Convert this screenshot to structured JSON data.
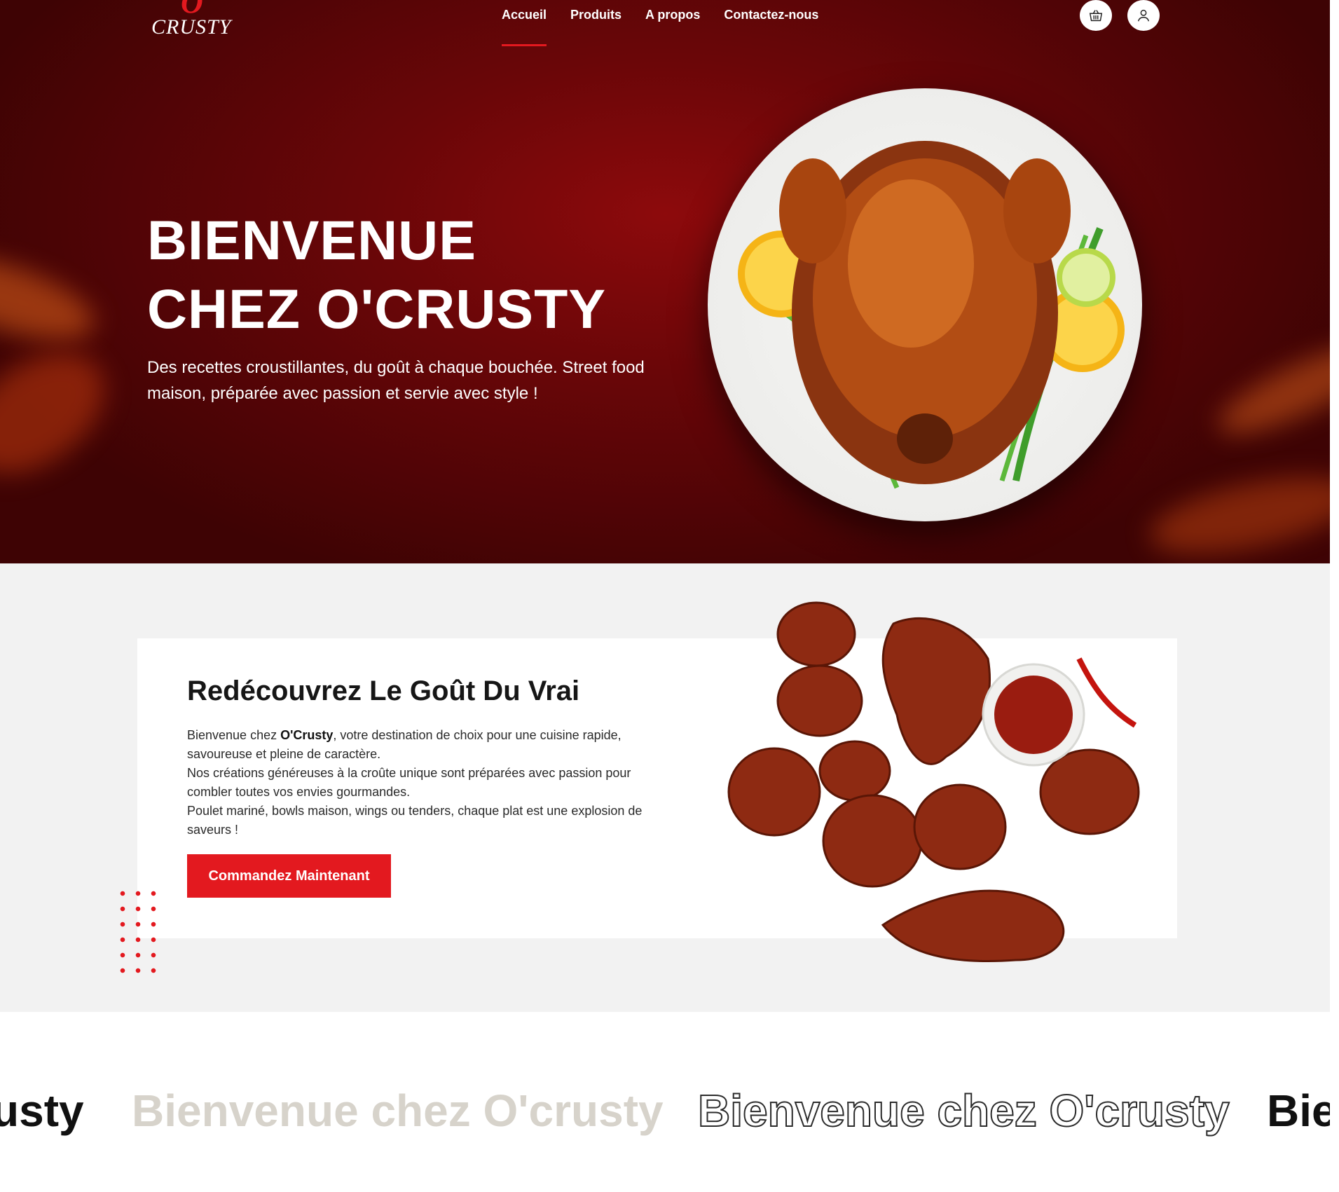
{
  "brand": {
    "mark": "O",
    "name": "CRUSTY"
  },
  "nav": {
    "items": [
      {
        "label": "Accueil",
        "active": true
      },
      {
        "label": "Produits",
        "active": false
      },
      {
        "label": "A propos",
        "active": false
      },
      {
        "label": "Contactez-nous",
        "active": false
      }
    ]
  },
  "header_icons": [
    "basket-icon",
    "user-icon"
  ],
  "hero": {
    "title_line1": "BIENVENUE",
    "title_line2": "CHEZ O'CRUSTY",
    "subtitle": "Des recettes croustillantes, du goût à chaque bouchée. Street food maison, préparée avec passion et servie avec style !"
  },
  "about": {
    "title": "Redécouvrez Le Goût Du Vrai",
    "para_intro": "Bienvenue chez ",
    "para_brand": "O'Crusty",
    "para_rest": ", votre destination de choix pour une cuisine rapide, savoureuse et pleine de caractère.",
    "line2": "Nos créations généreuses à la croûte unique sont préparées avec passion pour combler toutes vos envies gourmandes.",
    "line3": "Poulet mariné, bowls maison, wings ou tenders, chaque plat est une explosion de saveurs !",
    "cta_label": "Commandez Maintenant"
  },
  "marquee": {
    "items": [
      "usty",
      "Bienvenue chez O'crusty",
      "Bienvenue chez O'crusty",
      "Bier"
    ]
  },
  "colors": {
    "accent": "#e3191f",
    "hero_bg": "#6a0608",
    "section_bg": "#f2f2f2"
  }
}
